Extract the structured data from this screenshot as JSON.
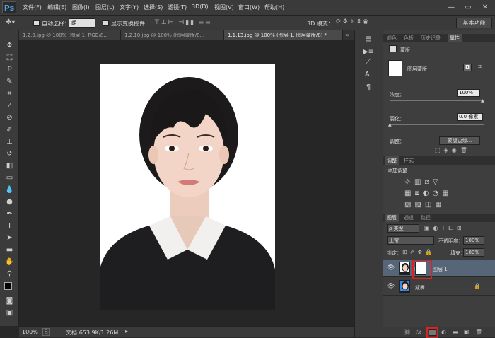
{
  "app": {
    "logo": "Ps"
  },
  "menu": [
    "文件(F)",
    "编辑(E)",
    "图像(I)",
    "图层(L)",
    "文字(Y)",
    "选择(S)",
    "滤镜(T)",
    "3D(D)",
    "视图(V)",
    "窗口(W)",
    "帮助(H)"
  ],
  "window_controls": {
    "minimize": "—",
    "maximize": "▭",
    "close": "✕"
  },
  "options": {
    "auto_select_label": "自动选择：",
    "auto_select_value": "组",
    "show_transform_label": "显示变换控件",
    "mode_3d_label": "3D 模式：",
    "workspace": "基本功能"
  },
  "tabs": [
    "1.2.9.jpg @ 100% (图层 1, RGB/8...",
    "1.2.10.jpg @ 100% (图层蒙版/8...",
    "1.1.13.jpg @ 100% (图层 1, 图层蒙版/8) *"
  ],
  "status": {
    "zoom": "100%",
    "doc": "文档:653.9K/1.26M"
  },
  "properties": {
    "tabs": [
      "颜色",
      "色板",
      "历史记录",
      "属性"
    ],
    "active_tab": "属性",
    "title": "蒙版",
    "mask_label": "图层蒙版",
    "density_label": "浓度：",
    "density_value": "100%",
    "feather_label": "羽化：",
    "feather_value": "0.0 像素",
    "adjust_label": "调整：",
    "mask_edge_button": "蒙版边缘..."
  },
  "adjustments": {
    "tabs": [
      "调整",
      "样式"
    ],
    "title": "添加调整"
  },
  "layers": {
    "tabs": [
      "图层",
      "通道",
      "路径"
    ],
    "filter_value": "ρ 类型",
    "blend_mode": "正常",
    "opacity_label": "不透明度：",
    "opacity_value": "100%",
    "lock_label": "锁定：",
    "fill_label": "填充：",
    "fill_value": "100%",
    "rows": [
      {
        "name": "图层 1"
      },
      {
        "name": "背景"
      }
    ]
  },
  "colors": {
    "accent_red": "#e02020",
    "foreground": "#000000",
    "background": "#ffffff"
  }
}
